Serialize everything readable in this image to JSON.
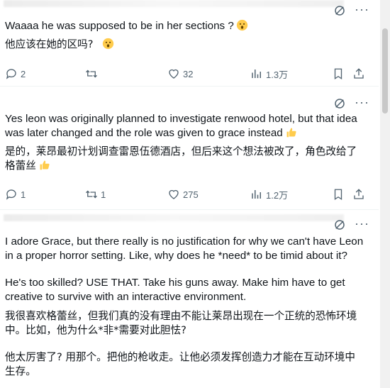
{
  "tweets": [
    {
      "en": "Waaaa he was supposed to be in her sections ?",
      "cn": "他应该在她的区吗?",
      "stats": {
        "replies": "2",
        "retweets": "",
        "likes": "32",
        "views": "1.3万"
      }
    },
    {
      "en": "Yes leon was originally planned to investigate renwood hotel, but that idea was later changed and the role was given to grace instead",
      "cn": "是的，莱昂最初计划调查雷恩伍德酒店，但后来这个想法被改了，角色改给了格蕾丝",
      "stats": {
        "replies": "1",
        "retweets": "1",
        "likes": "275",
        "views": "1.2万"
      }
    },
    {
      "en1": "I adore Grace,  but there really is no justification for why we can't have Leon in a proper horror setting. Like, why does he *need* to be timid about it?",
      "en2": "He's too skilled? USE THAT. Take his guns away. Make him have to get creative to survive with an interactive environment.",
      "cn1": "我很喜欢格蕾丝，但我们真的没有理由不能让莱昂出现在一个正统的恐怖环境中。比如，他为什么*非*需要对此胆怯?",
      "cn2": "他太厉害了? 用那个。把他的枪收走。让他必须发挥创造力才能在互动环境中生存。"
    }
  ]
}
